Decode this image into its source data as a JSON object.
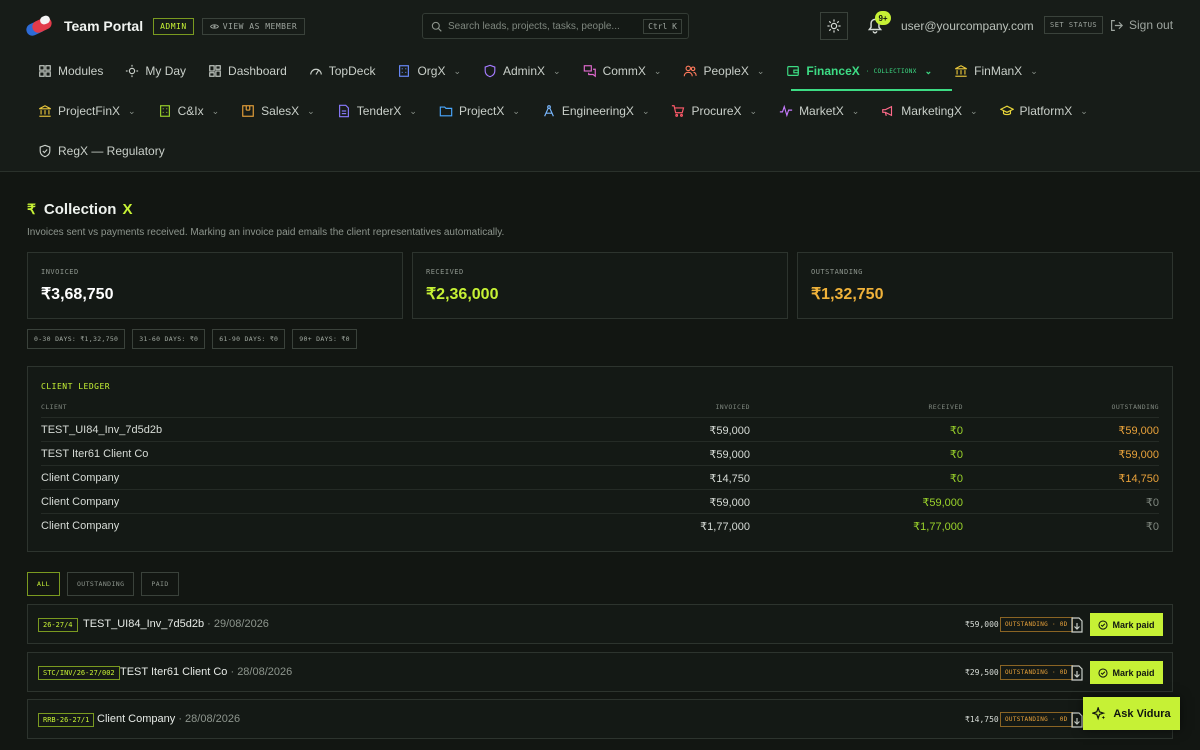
{
  "header": {
    "brand": "Team Portal",
    "role_badge": "ADMIN",
    "view_as": "VIEW AS MEMBER",
    "search_placeholder": "Search leads, projects, tasks, people...",
    "search_shortcut": "Ctrl K",
    "notifications_count": "9+",
    "user_email": "user@yourcompany.com",
    "set_status": "SET STATUS",
    "sign_out": "Sign out"
  },
  "nav": {
    "row1": [
      {
        "label": "Modules",
        "icon": "grid-icon",
        "chevron": false
      },
      {
        "label": "My Day",
        "icon": "sun-icon",
        "chevron": false
      },
      {
        "label": "Dashboard",
        "icon": "dashboard-icon",
        "chevron": false
      },
      {
        "label": "TopDeck",
        "icon": "gauge-icon",
        "chevron": false
      },
      {
        "label": "OrgX",
        "icon": "building-icon",
        "chevron": true
      },
      {
        "label": "AdminX",
        "icon": "shield-icon",
        "chevron": true
      },
      {
        "label": "CommX",
        "icon": "chat-icon",
        "chevron": true
      },
      {
        "label": "PeopleX",
        "icon": "people-icon",
        "chevron": true
      },
      {
        "label": "FinanceX",
        "icon": "wallet-icon",
        "chevron": true,
        "active": true,
        "sub": "· COLLECTIONX"
      },
      {
        "label": "FinManX",
        "icon": "bank-icon",
        "chevron": true
      }
    ],
    "row2": [
      {
        "label": "ProjectFinX",
        "icon": "bank-icon",
        "chevron": true
      },
      {
        "label": "C&Ix",
        "icon": "building-icon",
        "chevron": true
      },
      {
        "label": "SalesX",
        "icon": "box-icon",
        "chevron": true
      },
      {
        "label": "TenderX",
        "icon": "file-icon",
        "chevron": true
      },
      {
        "label": "ProjectX",
        "icon": "folder-icon",
        "chevron": true
      },
      {
        "label": "EngineeringX",
        "icon": "compass-icon",
        "chevron": true
      },
      {
        "label": "ProcureX",
        "icon": "cart-icon",
        "chevron": true
      },
      {
        "label": "MarketX",
        "icon": "pulse-icon",
        "chevron": true
      },
      {
        "label": "MarketingX",
        "icon": "megaphone-icon",
        "chevron": true
      },
      {
        "label": "PlatformX",
        "icon": "cap-icon",
        "chevron": true
      }
    ],
    "row3": [
      {
        "label": "RegX — Regulatory",
        "icon": "shield-icon",
        "chevron": false
      }
    ]
  },
  "page": {
    "title": "Collection",
    "title_suffix": "X",
    "subtitle": "Invoices sent vs payments received. Marking an invoice paid emails the client representatives automatically."
  },
  "stats": [
    {
      "label": "INVOICED",
      "value": "₹3,68,750",
      "color": "#ffffff"
    },
    {
      "label": "RECEIVED",
      "value": "₹2,36,000",
      "color": "#c6f135"
    },
    {
      "label": "OUTSTANDING",
      "value": "₹1,32,750",
      "color": "#f0b23a"
    }
  ],
  "aging": [
    "0-30 DAYS: ₹1,32,750",
    "31-60 DAYS: ₹0",
    "61-90 DAYS: ₹0",
    "90+ DAYS: ₹0"
  ],
  "ledger": {
    "title": "CLIENT LEDGER",
    "columns": [
      "CLIENT",
      "INVOICED",
      "RECEIVED",
      "OUTSTANDING"
    ],
    "rows": [
      {
        "client": "TEST_UI84_Inv_7d5d2b",
        "invoiced": "₹59,000",
        "received": "₹0",
        "outstanding": "₹59,000"
      },
      {
        "client": "TEST Iter61 Client Co",
        "invoiced": "₹59,000",
        "received": "₹0",
        "outstanding": "₹59,000"
      },
      {
        "client": "Client Company",
        "invoiced": "₹14,750",
        "received": "₹0",
        "outstanding": "₹14,750"
      },
      {
        "client": "Client Company",
        "invoiced": "₹59,000",
        "received": "₹59,000",
        "outstanding": "₹0"
      },
      {
        "client": "Client Company",
        "invoiced": "₹1,77,000",
        "received": "₹1,77,000",
        "outstanding": "₹0"
      }
    ]
  },
  "filters": [
    "ALL",
    "OUTSTANDING",
    "PAID"
  ],
  "invoices": [
    {
      "number": "26-27/4",
      "client": "TEST_UI84_Inv_7d5d2b",
      "date": "29/08/2026",
      "amount": "₹59,000",
      "status": "OUTSTANDING · 0D",
      "action": "Mark paid"
    },
    {
      "number": "STC/INV/26-27/002",
      "client": "TEST Iter61 Client Co",
      "date": "28/08/2026",
      "amount": "₹29,500",
      "status": "OUTSTANDING · 0D",
      "action": "Mark paid"
    },
    {
      "number": "RRB-26-27/1",
      "client": "Client Company",
      "date": "28/08/2026",
      "amount": "₹14,750",
      "status": "OUTSTANDING · 0D",
      "action": "Mark paid"
    }
  ],
  "assistant": {
    "label": "Ask Vidura"
  }
}
